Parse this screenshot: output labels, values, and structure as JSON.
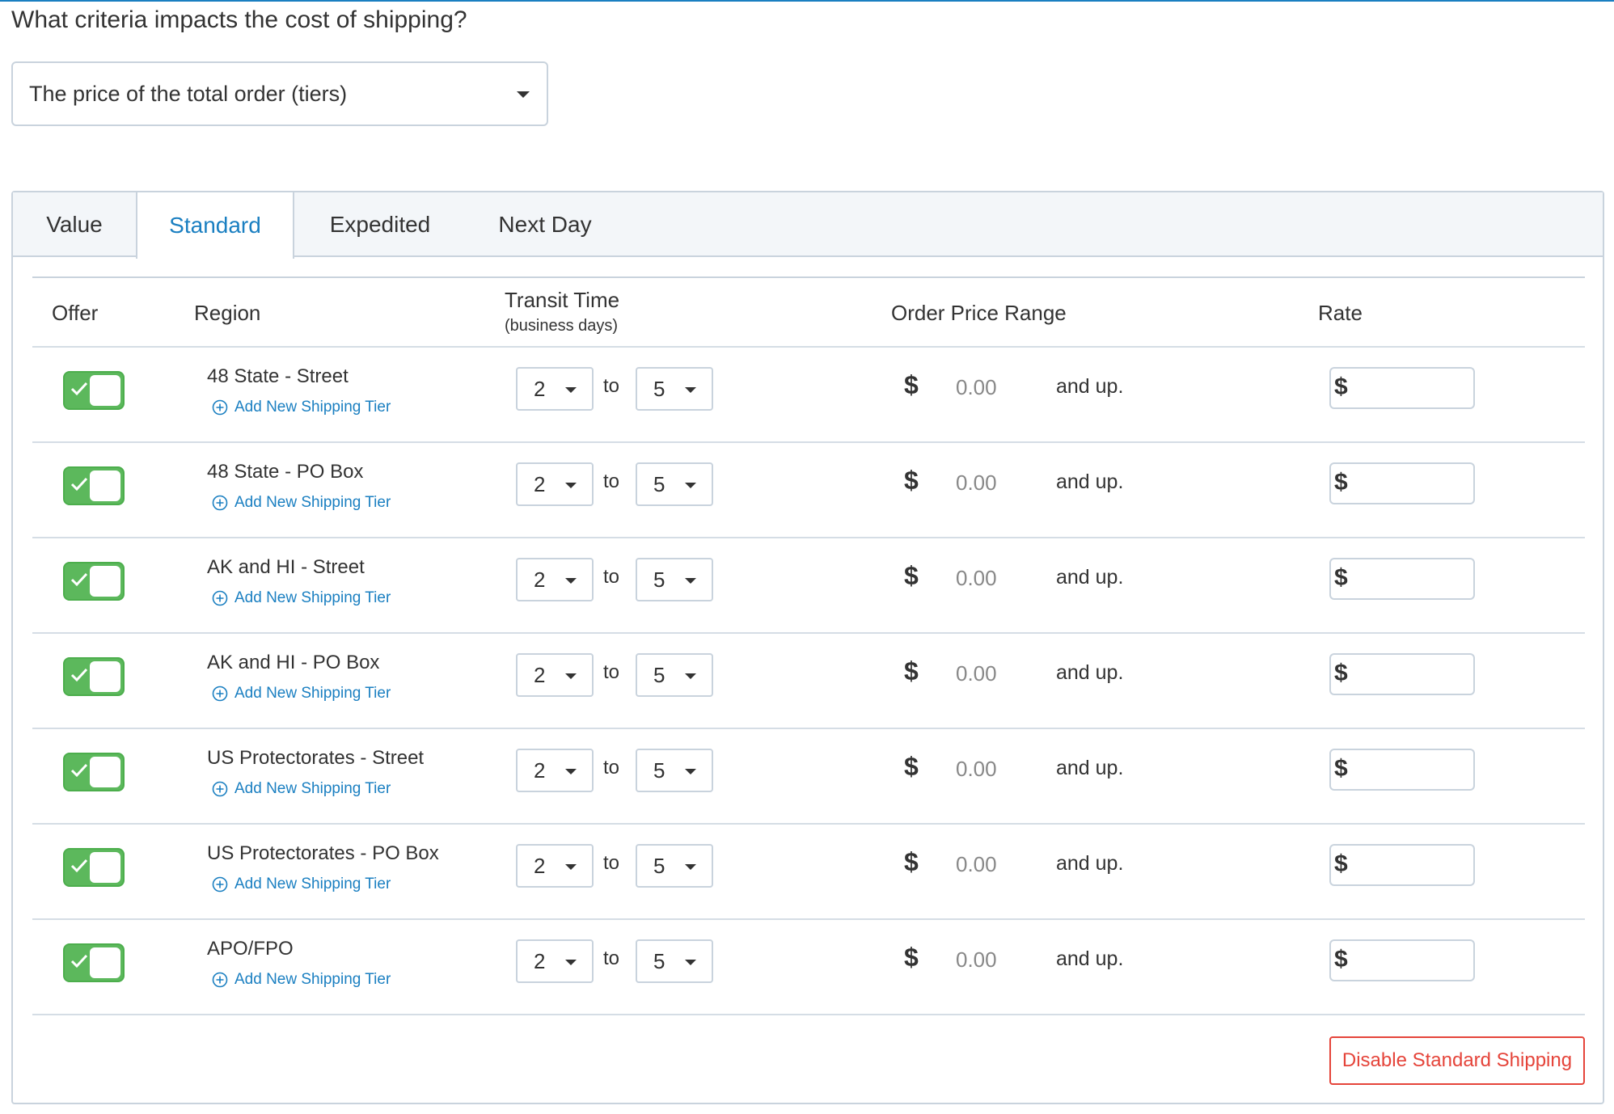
{
  "question": "What criteria impacts the cost of shipping?",
  "criteria_select": {
    "value": "The price of the total order (tiers)"
  },
  "tabs": [
    {
      "label": "Value",
      "active": false
    },
    {
      "label": "Standard",
      "active": true
    },
    {
      "label": "Expedited",
      "active": false
    },
    {
      "label": "Next Day",
      "active": false
    }
  ],
  "table": {
    "headers": {
      "offer": "Offer",
      "region": "Region",
      "transit": "Transit Time",
      "transit_sub": "(business days)",
      "price_range": "Order Price Range",
      "rate": "Rate"
    },
    "rows": [
      {
        "offer": true,
        "region": "48 State - Street",
        "add_tier": "Add New Shipping Tier",
        "transit_from": "2",
        "to_word": "to",
        "transit_to": "5",
        "currency": "$",
        "price_from": "0.00",
        "and_up": "and up.",
        "rate_currency": "$",
        "rate_value": ""
      },
      {
        "offer": true,
        "region": "48 State - PO Box",
        "add_tier": "Add New Shipping Tier",
        "transit_from": "2",
        "to_word": "to",
        "transit_to": "5",
        "currency": "$",
        "price_from": "0.00",
        "and_up": "and up.",
        "rate_currency": "$",
        "rate_value": ""
      },
      {
        "offer": true,
        "region": "AK and HI - Street",
        "add_tier": "Add New Shipping Tier",
        "transit_from": "2",
        "to_word": "to",
        "transit_to": "5",
        "currency": "$",
        "price_from": "0.00",
        "and_up": "and up.",
        "rate_currency": "$",
        "rate_value": ""
      },
      {
        "offer": true,
        "region": "AK and HI - PO Box",
        "add_tier": "Add New Shipping Tier",
        "transit_from": "2",
        "to_word": "to",
        "transit_to": "5",
        "currency": "$",
        "price_from": "0.00",
        "and_up": "and up.",
        "rate_currency": "$",
        "rate_value": ""
      },
      {
        "offer": true,
        "region": "US Protectorates - Street",
        "add_tier": "Add New Shipping Tier",
        "transit_from": "2",
        "to_word": "to",
        "transit_to": "5",
        "currency": "$",
        "price_from": "0.00",
        "and_up": "and up.",
        "rate_currency": "$",
        "rate_value": ""
      },
      {
        "offer": true,
        "region": "US Protectorates - PO Box",
        "add_tier": "Add New Shipping Tier",
        "transit_from": "2",
        "to_word": "to",
        "transit_to": "5",
        "currency": "$",
        "price_from": "0.00",
        "and_up": "and up.",
        "rate_currency": "$",
        "rate_value": ""
      },
      {
        "offer": true,
        "region": "APO/FPO",
        "add_tier": "Add New Shipping Tier",
        "transit_from": "2",
        "to_word": "to",
        "transit_to": "5",
        "currency": "$",
        "price_from": "0.00",
        "and_up": "and up.",
        "rate_currency": "$",
        "rate_value": ""
      }
    ]
  },
  "disable_button": "Disable Standard Shipping",
  "colors": {
    "accent": "#1a7fc1",
    "toggle_on": "#5cb85c",
    "danger": "#e5443a",
    "border": "#c9d3dd"
  },
  "icons": {
    "dropdown": "caret-down-icon",
    "toggle_check": "check-icon",
    "add": "plus-circle-icon"
  }
}
